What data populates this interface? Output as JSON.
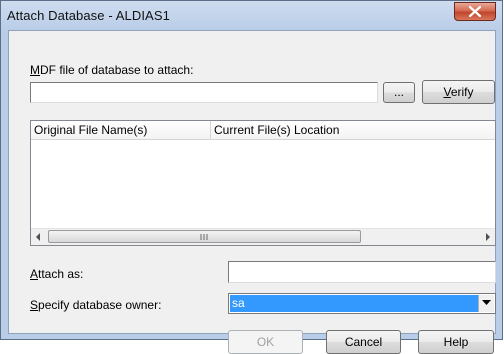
{
  "window": {
    "title": "Attach Database - ALDIAS1"
  },
  "mdf": {
    "label_prefix": "M",
    "label_rest": "DF file of database to attach:",
    "value": "",
    "browse_label": "...",
    "verify_prefix": "V",
    "verify_rest": "erify"
  },
  "files_list": {
    "columns": [
      "Original File Name(s)",
      "Current File(s) Location"
    ],
    "rows": []
  },
  "attach_as": {
    "label_prefix": "A",
    "label_rest": "ttach as:",
    "value": ""
  },
  "owner": {
    "label_prefix": "S",
    "label_rest": "pecify database owner:",
    "selected": "sa"
  },
  "buttons": {
    "ok": "OK",
    "cancel": "Cancel",
    "help": "Help"
  },
  "colors": {
    "selection": "#3399ff",
    "close_button": "#c0462c",
    "title_bar": "#b9cde8"
  }
}
